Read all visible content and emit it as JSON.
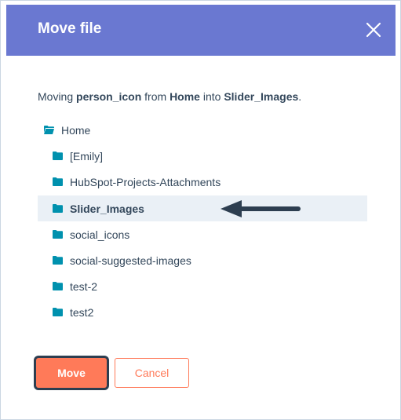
{
  "dialog": {
    "title": "Move file",
    "close_icon": "close-icon"
  },
  "message": {
    "prefix": "Moving",
    "file_name": "person_icon",
    "from_word": "from",
    "source": "Home",
    "into_word": "into",
    "destination": "Slider_Images",
    "suffix": "."
  },
  "tree": {
    "root": {
      "label": "Home",
      "icon": "folder-open-icon"
    },
    "folders": [
      {
        "label": "[Emily]",
        "icon": "folder-icon",
        "selected": false
      },
      {
        "label": "HubSpot-Projects-Attachments",
        "icon": "folder-icon",
        "selected": false
      },
      {
        "label": "Slider_Images",
        "icon": "folder-icon",
        "selected": true
      },
      {
        "label": "social_icons",
        "icon": "folder-icon",
        "selected": false
      },
      {
        "label": "social-suggested-images",
        "icon": "folder-icon",
        "selected": false
      },
      {
        "label": "test-2",
        "icon": "folder-icon",
        "selected": false
      },
      {
        "label": "test2",
        "icon": "folder-icon",
        "selected": false
      }
    ]
  },
  "annotation": {
    "icon": "arrow-left-icon"
  },
  "buttons": {
    "move_label": "Move",
    "cancel_label": "Cancel"
  },
  "colors": {
    "header": "#6a78d1",
    "accent": "#ff7a59",
    "folder": "#0091ae",
    "text": "#33475b",
    "selected_row": "#eaf0f6",
    "arrow": "#2d3e50"
  }
}
